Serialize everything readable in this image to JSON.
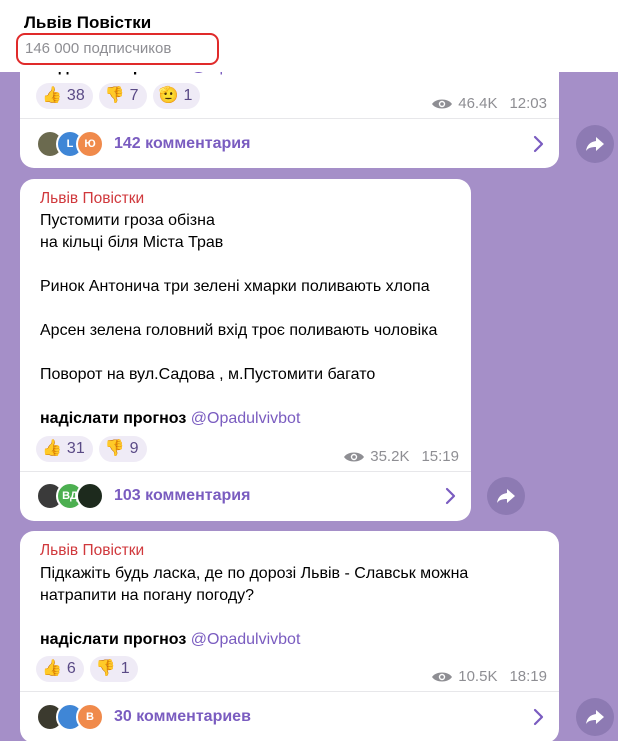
{
  "channel": {
    "title": "Львів Повістки",
    "subscribers": "146 000 подписчиков"
  },
  "posts": [
    {
      "forecast_label": "надіслати прогноз",
      "forecast_bot": "@Opadulvivbot",
      "reactions": [
        {
          "emoji": "👍",
          "count": "38"
        },
        {
          "emoji": "👎",
          "count": "7"
        },
        {
          "emoji": "🫡",
          "count": "1"
        }
      ],
      "views": "46.4K",
      "time": "12:03",
      "comments": "142 комментария",
      "avatar_letters": [
        "",
        "L",
        "Ю"
      ],
      "avatar_colors": [
        "#6b6a4f",
        "#3f86d6",
        "#f08a4b"
      ]
    },
    {
      "sender": "Львів Повістки",
      "text": "Пустомити гроза обізна\nна кільці біля Міста Трав\n\nРинок Антонича три зелені хмарки поливають хлопа\n\nАрсен зелена головний вхід троє поливають чоловіка\n\nПоворот на вул.Садова , м.Пустомити багато",
      "forecast_label": "надіслати прогноз",
      "forecast_bot": "@Opadulvivbot",
      "reactions": [
        {
          "emoji": "👍",
          "count": "31"
        },
        {
          "emoji": "👎",
          "count": "9"
        }
      ],
      "views": "35.2K",
      "time": "15:19",
      "comments": "103 комментария",
      "avatar_letters": [
        "",
        "ВД",
        ""
      ],
      "avatar_colors": [
        "#3a3a3a",
        "#4caf50",
        "#1d2a1d"
      ]
    },
    {
      "sender": "Львів Повістки",
      "text": "Підкажіть будь ласка, де по дорозі Львів - Славськ можна\nнатрапити на погану погоду?",
      "forecast_label": "надіслати прогноз",
      "forecast_bot": "@Opadulvivbot",
      "reactions": [
        {
          "emoji": "👍",
          "count": "6"
        },
        {
          "emoji": "👎",
          "count": "1"
        }
      ],
      "views": "10.5K",
      "time": "18:19",
      "comments": "30 комментариев",
      "avatar_letters": [
        "",
        "",
        "В"
      ],
      "avatar_colors": [
        "#3b3a2e",
        "#3f86d6",
        "#f08a4b"
      ]
    }
  ]
}
